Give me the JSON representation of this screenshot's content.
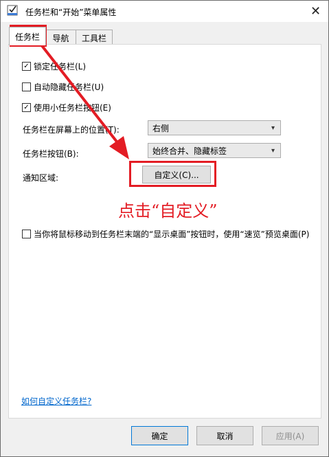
{
  "window": {
    "title": "任务栏和“开始”菜单属性",
    "close_glyph": "✕"
  },
  "tabs": [
    {
      "label": "任务栏",
      "active": true
    },
    {
      "label": "导航",
      "active": false
    },
    {
      "label": "工具栏",
      "active": false
    }
  ],
  "checkboxes": [
    {
      "label": "锁定任务栏(L)",
      "checked": true,
      "mark": "✓"
    },
    {
      "label": "自动隐藏任务栏(U)",
      "checked": false,
      "mark": ""
    },
    {
      "label": "使用小任务栏按钮(E)",
      "checked": true,
      "mark": "✓"
    }
  ],
  "position": {
    "label": "任务栏在屏幕上的位置(T):",
    "value": "右侧"
  },
  "buttons_setting": {
    "label": "任务栏按钮(B):",
    "value": "始终合并、隐藏标签"
  },
  "notification": {
    "label": "通知区域:",
    "button": "自定义(C)..."
  },
  "peek": {
    "label": "当你将鼠标移动到任务栏末端的“显示桌面”按钮时，使用“速览”预览桌面(P)",
    "checked": false,
    "mark": ""
  },
  "link": "如何自定义任务栏?",
  "footer": {
    "ok": "确定",
    "cancel": "取消",
    "apply": "应用(A)"
  },
  "annotation": {
    "text": "点击“自定义”",
    "color": "#e31c24"
  },
  "icons": {
    "dropdown": "▾"
  }
}
